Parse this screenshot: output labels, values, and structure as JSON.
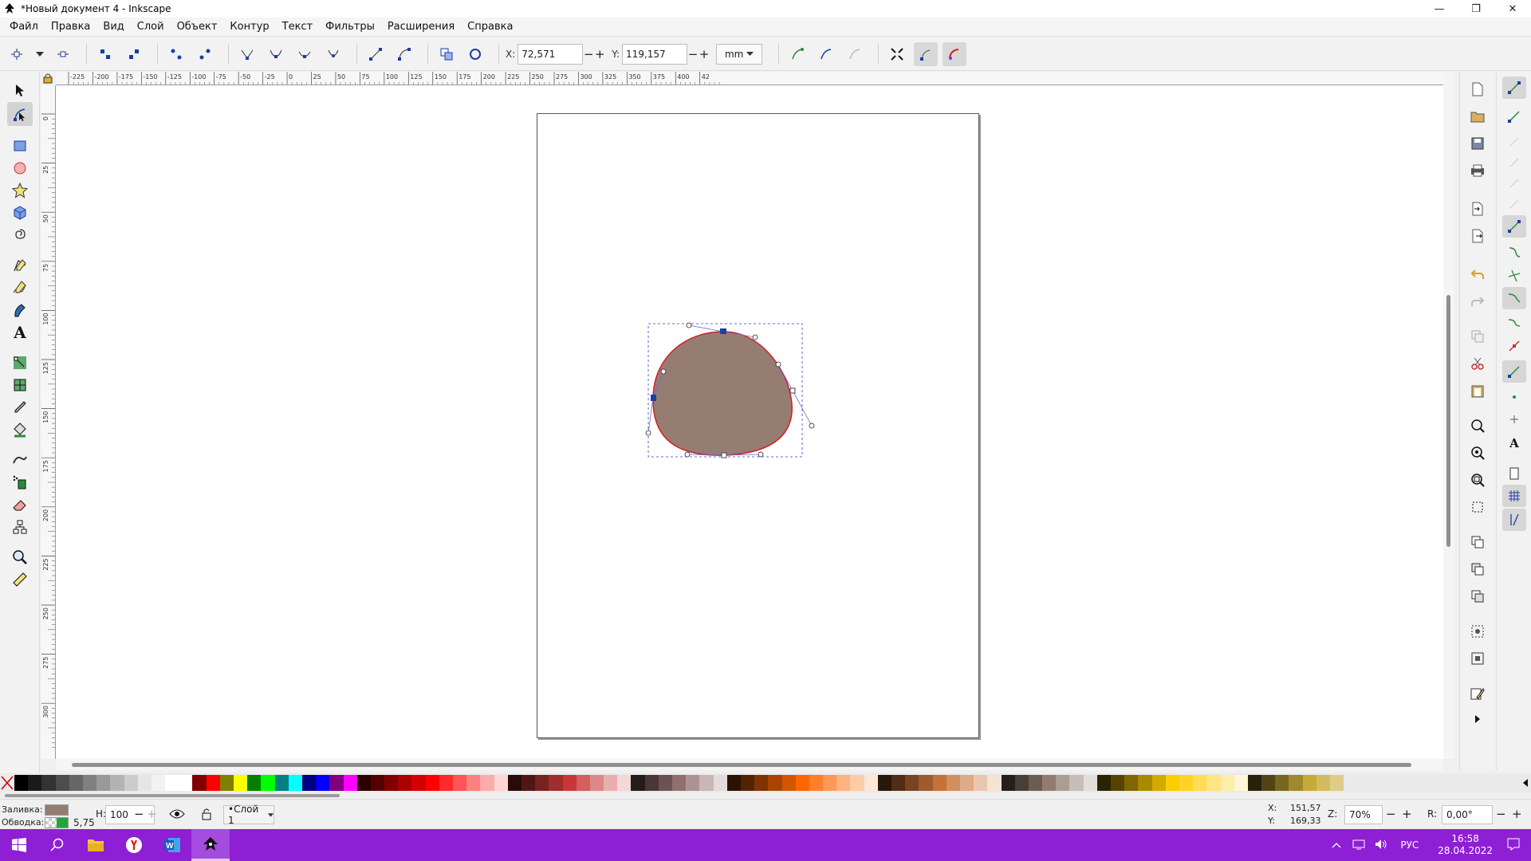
{
  "window": {
    "title": "*Новый документ 4 - Inkscape",
    "controls": [
      "—",
      "❐",
      "✕"
    ]
  },
  "menu": [
    "Файл",
    "Правка",
    "Вид",
    "Слой",
    "Объект",
    "Контур",
    "Текст",
    "Фильтры",
    "Расширения",
    "Справка"
  ],
  "tool_controls": {
    "x_label": "X:",
    "x_value": "72,571",
    "y_label": "Y:",
    "y_value": "119,157",
    "unit": "mm"
  },
  "ruler": {
    "h_ticks": [
      "-225",
      "-200",
      "-175",
      "-150",
      "-125",
      "-100",
      "-75",
      "-50",
      "-25",
      "0",
      "25",
      "50",
      "75",
      "100",
      "125",
      "150",
      "175",
      "200",
      "225",
      "250",
      "275",
      "300",
      "325",
      "350",
      "375",
      "400",
      "42"
    ],
    "v_ticks": [
      "0",
      "25",
      "50",
      "75",
      "100",
      "125",
      "150",
      "175",
      "200",
      "225",
      "250",
      "275",
      "300"
    ]
  },
  "palette": {
    "colors": [
      "#000000",
      "#1a1a1a",
      "#333333",
      "#4d4d4d",
      "#666666",
      "#808080",
      "#999999",
      "#b3b3b3",
      "#cccccc",
      "#e6e6e6",
      "#f2f2f2",
      "#ffffff",
      "#ffffff",
      "#800000",
      "#ff0000",
      "#808000",
      "#ffff00",
      "#008000",
      "#00ff00",
      "#008080",
      "#00ffff",
      "#000080",
      "#0000ff",
      "#800080",
      "#ff00ff",
      "#2b0000",
      "#550000",
      "#800000",
      "#aa0000",
      "#d40000",
      "#ff0000",
      "#ff2a2a",
      "#ff5555",
      "#ff8080",
      "#ffaaaa",
      "#ffd5d5",
      "#280b0b",
      "#501616",
      "#782121",
      "#a02c2c",
      "#c83737",
      "#d35f5f",
      "#de8787",
      "#e9afaf",
      "#f4d7d7",
      "#241c1c",
      "#483737",
      "#6c5353",
      "#916f6f",
      "#ac9393",
      "#c8b7b7",
      "#e3dbdb",
      "#2b1100",
      "#552200",
      "#803300",
      "#aa4400",
      "#d45500",
      "#ff6600",
      "#ff7f2a",
      "#ff9955",
      "#ffb380",
      "#ffccaa",
      "#ffe6d5",
      "#28170b",
      "#502d16",
      "#784421",
      "#a05a2c",
      "#c87137",
      "#d38d5f",
      "#deaa87",
      "#e9c6af",
      "#f4e3d7",
      "#241f1c",
      "#483e37",
      "#6c5d53",
      "#917c6f",
      "#ac9d93",
      "#c8beb7",
      "#e3dedb",
      "#2b2200",
      "#554400",
      "#806600",
      "#aa8800",
      "#d4aa00",
      "#ffcc00",
      "#ffd42a",
      "#ffdd55",
      "#ffe680",
      "#ffeeaa",
      "#fff6d5",
      "#28220b",
      "#504416",
      "#786721",
      "#a0892c",
      "#c8ab37",
      "#d3bc5f",
      "#decd87"
    ]
  },
  "status": {
    "fill_label": "Заливка:",
    "stroke_label": "Обводка:",
    "stroke_width": "5,75",
    "h_label": "Н:",
    "h_value": "100",
    "layer": "•Слой 1",
    "coord_x_label": "X:",
    "coord_x": "151,57",
    "coord_y_label": "Y:",
    "coord_y": "169,33",
    "zoom_label": "Z:",
    "zoom": "70%",
    "rotate_label": "R:",
    "rotate": "0,00°",
    "fill_color": "#967d72",
    "stroke_color": "#22a63a"
  },
  "taskbar": {
    "lang": "РУС",
    "time": "16:58",
    "date": "28.04.2022",
    "bg_color": "#8e1fd4"
  },
  "shape": {
    "fill": "#967d72",
    "stroke": "#d32020"
  }
}
